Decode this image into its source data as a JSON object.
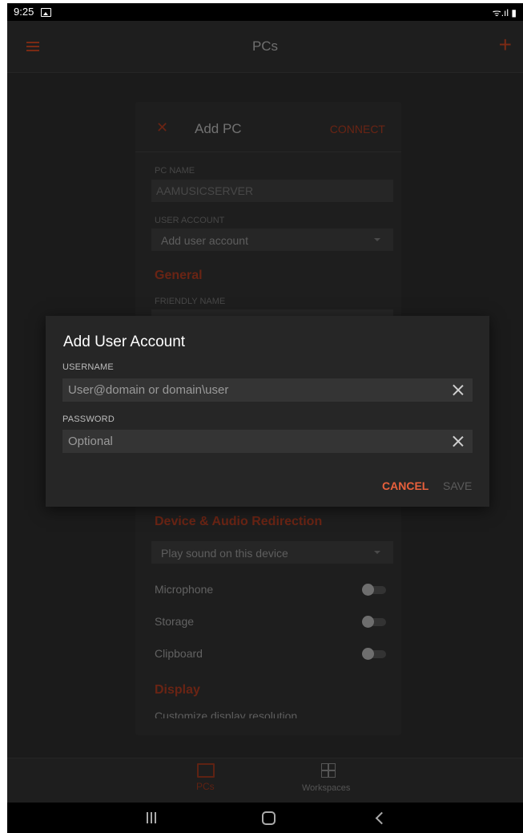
{
  "status_bar": {
    "time": "9:25",
    "icons": "ᯤ.ıl ▮"
  },
  "app_bar": {
    "title": "PCs"
  },
  "add_pc": {
    "title": "Add PC",
    "connect_label": "CONNECT",
    "pc_name_label": "PC NAME",
    "pc_name_value": "AAMUSICSERVER",
    "user_account_label": "USER ACCOUNT",
    "user_account_value": "Add user account",
    "general_heading": "General",
    "friendly_name_label": "FRIENDLY NAME",
    "device_audio_heading": "Device & Audio Redirection",
    "sound_option": "Play sound on this device",
    "microphone_label": "Microphone",
    "storage_label": "Storage",
    "clipboard_label": "Clipboard",
    "display_heading": "Display",
    "display_resolution_label": "Customize display resolution"
  },
  "dialog": {
    "title": "Add User Account",
    "username_label": "USERNAME",
    "username_placeholder": "User@domain or domain\\user",
    "password_label": "PASSWORD",
    "password_placeholder": "Optional",
    "cancel_label": "CANCEL",
    "save_label": "SAVE"
  },
  "bottom_nav": {
    "items": [
      {
        "label": "PCs",
        "icon": "monitor-icon",
        "selected": true
      },
      {
        "label": "Workspaces",
        "icon": "workspaces-icon",
        "selected": false
      }
    ]
  },
  "colors": {
    "accent": "#e8603c",
    "background": "#1b1b1b",
    "dialog": "#262626"
  }
}
